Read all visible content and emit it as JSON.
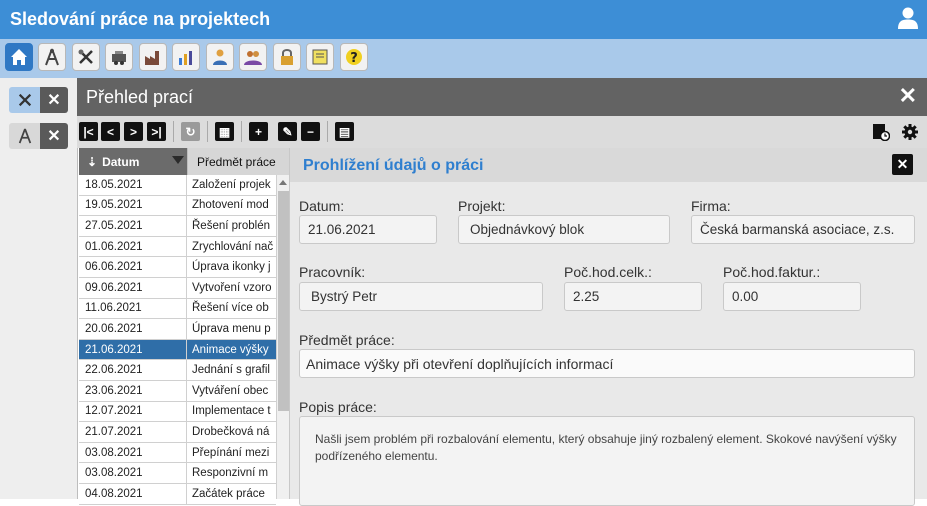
{
  "app": {
    "title": "Sledování práce na projektech"
  },
  "icons": {
    "user": "user-icon",
    "modules": [
      "home-icon",
      "compass-icon",
      "tools-icon",
      "machinery-icon",
      "factory-icon",
      "chart-icon",
      "worker-icon",
      "team-icon",
      "lock-key-icon",
      "certificate-icon",
      "help-icon"
    ]
  },
  "sidebar": {
    "tabs": [
      {
        "icon": "tools-icon",
        "active": true
      },
      {
        "icon": "compass-icon",
        "active": false
      }
    ]
  },
  "panel": {
    "title": "Přehled prací"
  },
  "grid": {
    "columns": [
      "Datum",
      "Předmět práce"
    ],
    "rows": [
      {
        "date": "18.05.2021",
        "subject": "Založení projek"
      },
      {
        "date": "19.05.2021",
        "subject": "Zhotovení mod"
      },
      {
        "date": "27.05.2021",
        "subject": "Řešení problén"
      },
      {
        "date": "01.06.2021",
        "subject": "Zrychlování nač"
      },
      {
        "date": "06.06.2021",
        "subject": "Úprava ikonky j"
      },
      {
        "date": "09.06.2021",
        "subject": "Vytvoření vzoro"
      },
      {
        "date": "11.06.2021",
        "subject": "Řešení více ob"
      },
      {
        "date": "20.06.2021",
        "subject": "Úprava menu p"
      },
      {
        "date": "21.06.2021",
        "subject": "Animace výšky",
        "selected": true
      },
      {
        "date": "22.06.2021",
        "subject": "Jednání s grafil"
      },
      {
        "date": "23.06.2021",
        "subject": "Vytváření obec"
      },
      {
        "date": "12.07.2021",
        "subject": "Implementace t"
      },
      {
        "date": "21.07.2021",
        "subject": "Drobečková ná"
      },
      {
        "date": "03.08.2021",
        "subject": "Přepínání mezi"
      },
      {
        "date": "03.08.2021",
        "subject": "Responzivní m"
      },
      {
        "date": "04.08.2021",
        "subject": "Začátek práce"
      }
    ]
  },
  "detail": {
    "title": "Prohlížení údajů o práci",
    "fields": {
      "datum": {
        "label": "Datum:",
        "value": "21.06.2021"
      },
      "projekt": {
        "label": "Projekt:",
        "value": "Objednávkový blok"
      },
      "firma": {
        "label": "Firma:",
        "value": "Česká barmanská asociace, z.s."
      },
      "pracovnik": {
        "label": "Pracovník:",
        "value": "Bystrý Petr"
      },
      "hod_celk": {
        "label": "Poč.hod.celk.:",
        "value": "2.25"
      },
      "hod_faktur": {
        "label": "Poč.hod.faktur.:",
        "value": "0.00"
      },
      "predmet": {
        "label": "Předmět práce:",
        "value": "Animace výšky při otevření doplňujících informací"
      },
      "popis": {
        "label": "Popis práce:",
        "value": "Našli jsem problém při rozbalování elementu, který obsahuje jiný rozbalený element. Skokové navýšení výšky podřízeného elementu."
      }
    }
  },
  "colors": {
    "topbar": "#3d8ed6",
    "iconbar": "#a9c9ea",
    "selected_row": "#2f6ea8",
    "detail_title": "#2f7fcf"
  }
}
